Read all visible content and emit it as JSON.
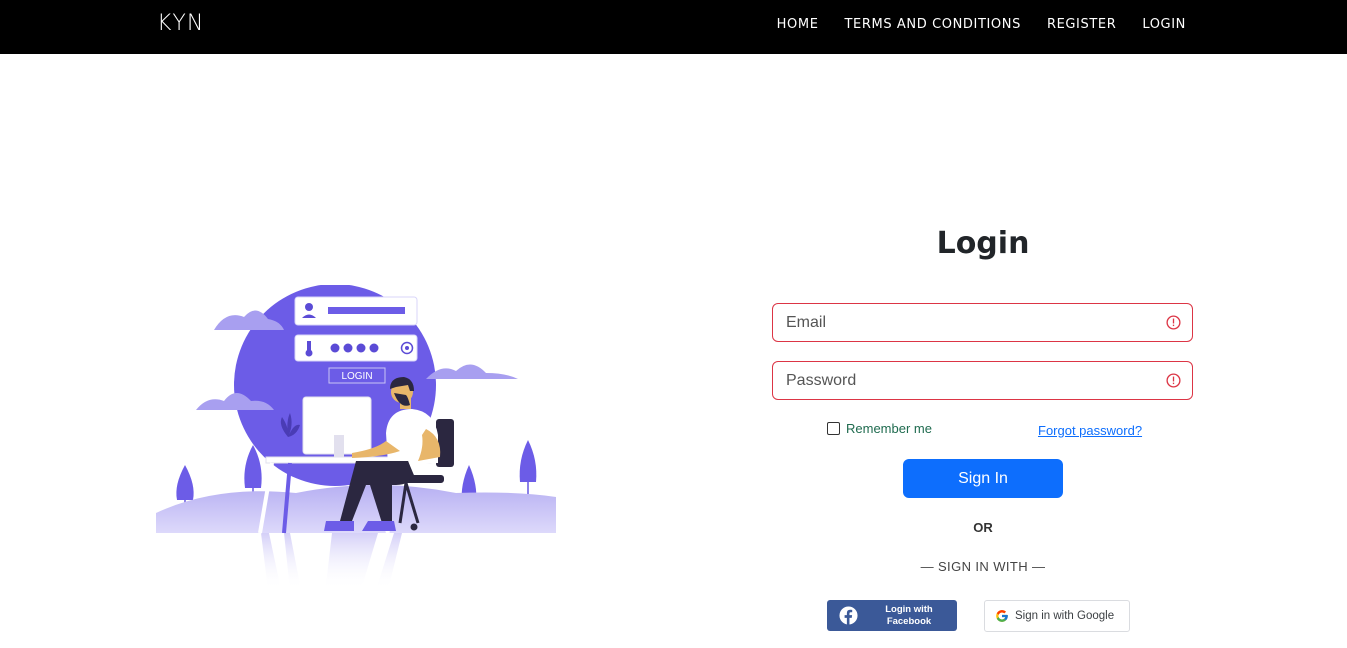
{
  "navbar": {
    "brand": "KYN",
    "links": [
      "HOME",
      "TERMS AND CONDITIONS",
      "REGISTER",
      "LOGIN"
    ]
  },
  "illustration": {
    "login_badge": "LOGIN"
  },
  "form": {
    "title": "Login",
    "email_placeholder": "Email",
    "password_placeholder": "Password",
    "remember_label": "Remember me",
    "forgot_label": "Forgot password?",
    "submit_label": "Sign In",
    "or_label": "OR",
    "sign_in_with_label": "— SIGN IN WITH —",
    "facebook_label": "Login with Facebook",
    "google_label": "Sign in with Google"
  },
  "colors": {
    "navbar_bg": "#000000",
    "primary": "#0d6efd",
    "invalid": "#dc3545",
    "facebook": "#3b5998",
    "illustration_accent": "#6c5ce7"
  }
}
